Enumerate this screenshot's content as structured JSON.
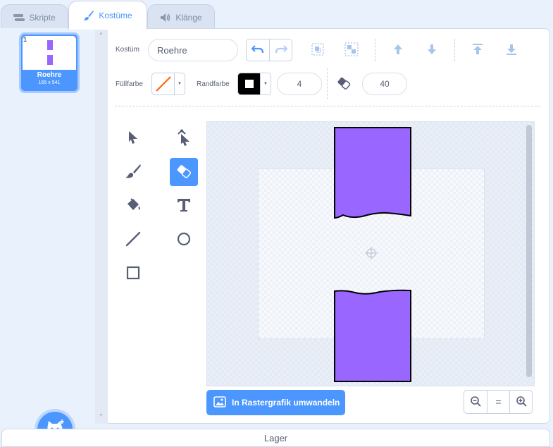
{
  "tabs": [
    {
      "label": "Skripte",
      "icon": "code-icon",
      "active": false
    },
    {
      "label": "Kostüme",
      "icon": "brush-icon",
      "active": true
    },
    {
      "label": "Klänge",
      "icon": "speaker-icon",
      "active": false
    }
  ],
  "costume_list": [
    {
      "number": "1",
      "name": "Roehre",
      "size": "165 x 541",
      "selected": true
    }
  ],
  "toolbar": {
    "costume_label": "Kostüm",
    "costume_name": "Roehre",
    "fill_label": "Füllfarbe",
    "outline_label": "Randfarbe",
    "outline_width": "4",
    "eraser_size": "40",
    "fill_color": "none (red slash)",
    "outline_color": "#000000"
  },
  "tools": [
    "select",
    "reshape",
    "brush",
    "eraser",
    "fill",
    "text",
    "line",
    "circle",
    "rectangle"
  ],
  "active_tool": "eraser",
  "canvas": {
    "shape_fill": "#9966ff",
    "shape_stroke": "#000000",
    "shapes": [
      "top-pipe",
      "bottom-pipe"
    ]
  },
  "convert_button": "In Rastergrafik umwandeln",
  "zoom": {
    "out": "zoom-out",
    "reset": "=",
    "in": "zoom-in"
  },
  "bottom_bar": "Lager",
  "colors": {
    "accent": "#4c97ff",
    "costume": "#9966ff"
  }
}
